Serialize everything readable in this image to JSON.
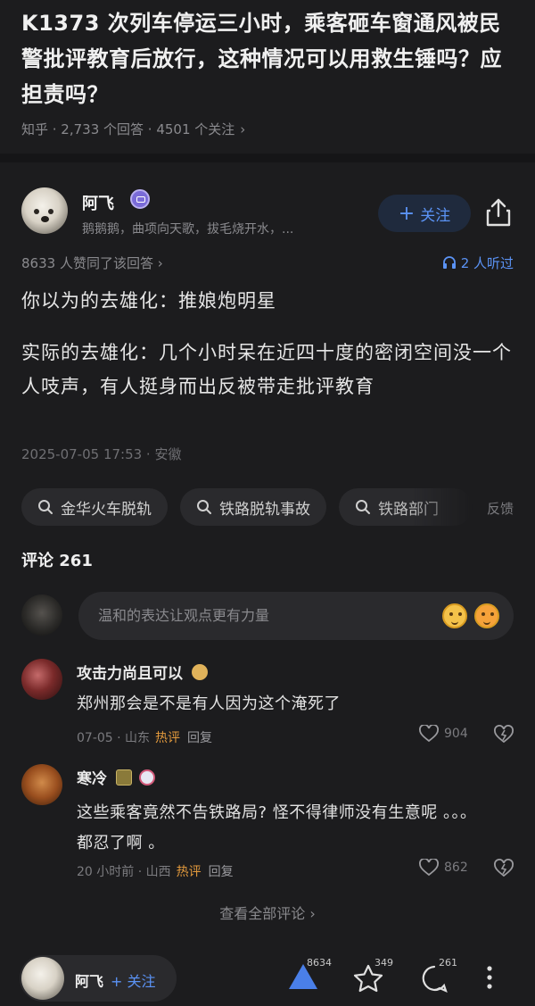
{
  "question": {
    "title": "K1373 次列车停运三小时，乘客砸车窗通风被民警批评教育后放行，这种情况可以用救生锤吗？应担责吗？",
    "meta": "知乎 · 2,733 个回答 · 4501 个关注",
    "chevron": "›"
  },
  "author": {
    "name": "阿飞",
    "bio": "鹅鹅鹅，曲项向天歌，拔毛烧开水，...",
    "follow_label": "关注",
    "follow_plus": "+"
  },
  "stats": {
    "likes_text": "8633 人赞同了该回答",
    "listen_text": "2 人听过"
  },
  "answer": {
    "p1": "你以为的去雄化：推娘炮明星",
    "p2": "实际的去雄化：几个小时呆在近四十度的密闭空间没一个人吱声，有人挺身而出反被带走批评教育",
    "date_location": "2025-07-05 17:53 · 安徽"
  },
  "chips": [
    "金华火车脱轨",
    "铁路脱轨事故",
    "铁路部门"
  ],
  "feedback_label": "反馈",
  "comments": {
    "title": "评论 261",
    "input_placeholder": "温和的表达让观点更有力量",
    "items": [
      {
        "name": "攻击力尚且可以",
        "text": "郑州那会是不是有人因为这个淹死了",
        "time_location": "07-05 · 山东",
        "hot": "热评",
        "reply": "回复",
        "likes": "904"
      },
      {
        "name": "寒冷",
        "text": "这些乘客竟然不告铁路局? 怪不得律师没有生意呢 。。。都忍了啊 。",
        "time_location": "20 小时前 · 山西",
        "hot": "热评",
        "reply": "回复",
        "likes": "862"
      }
    ],
    "view_all": "查看全部评论 ›"
  },
  "bottom_bar": {
    "author_name": "阿飞",
    "follow_label": "+ 关注",
    "upvote_count": "8634",
    "star_count": "349",
    "comment_count": "261"
  },
  "colors": {
    "background": "#1c1c1e",
    "accent_blue": "#5b93f5",
    "hot_orange": "#e39a3d"
  },
  "icons": [
    "chevron-right-icon",
    "verified-badge-icon",
    "share-icon",
    "headphones-icon",
    "search-icon",
    "emoji-icon",
    "heart-icon",
    "dislike-icon",
    "upvote-icon",
    "star-icon",
    "comment-icon",
    "more-icon"
  ]
}
